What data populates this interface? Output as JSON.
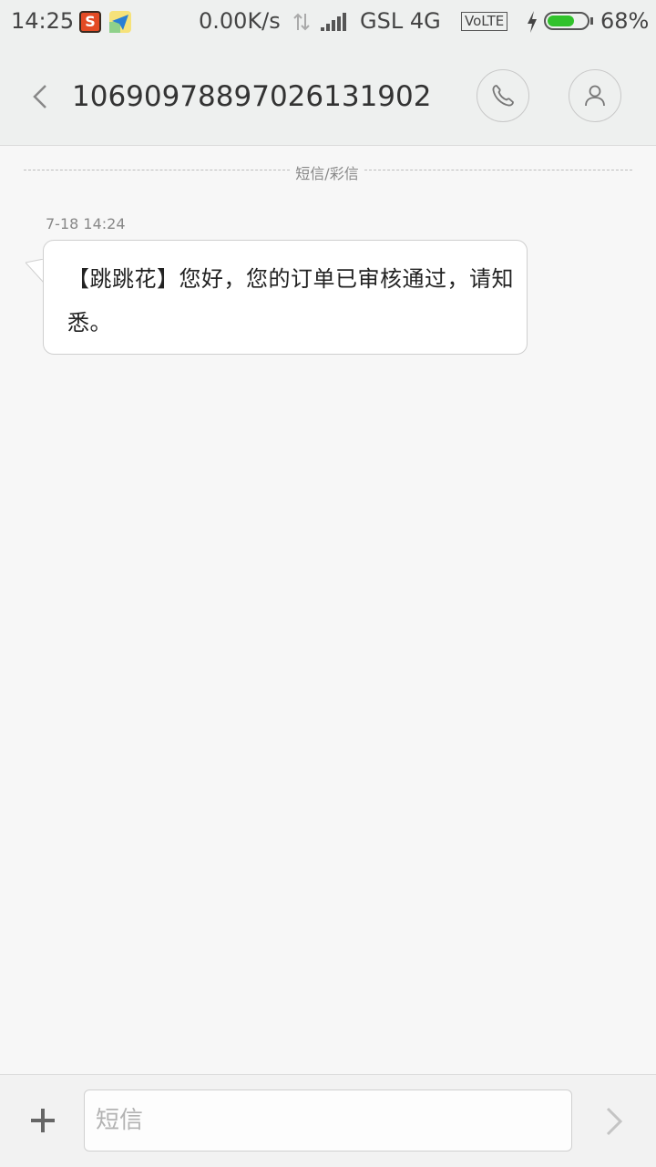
{
  "status_bar": {
    "time": "14:25",
    "net_speed": "0.00K/s",
    "carrier": "GSL 4G",
    "volte": "VoLTE",
    "battery_text": "68%",
    "battery_level": 0.68,
    "battery_color": "#31c22c",
    "icons": [
      "app-s-icon",
      "paper-plane-icon",
      "data-arrows-icon",
      "signal-icon",
      "charging-icon",
      "battery-icon"
    ]
  },
  "header": {
    "contact": "10690978897026131902",
    "icons": [
      "back-arrow-icon",
      "phone-icon",
      "contact-icon"
    ]
  },
  "conversation": {
    "divider_label": "短信/彩信",
    "messages": [
      {
        "time": "7-18 14:24",
        "text": "【跳跳花】您好，您的订单已审核通过，请知悉。"
      }
    ]
  },
  "input_bar": {
    "placeholder": "短信",
    "value": "",
    "icons": [
      "plus-icon",
      "send-arrow-icon"
    ]
  }
}
